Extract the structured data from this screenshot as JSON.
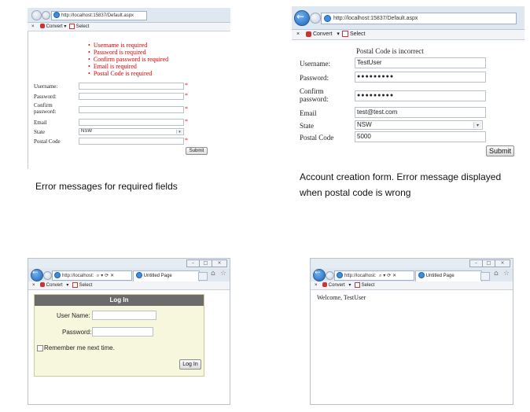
{
  "panels": {
    "p1": {
      "url": "http://localhost:15837/Default.aspx",
      "toolbar": {
        "close": "×",
        "convert": "Convert",
        "convert_arrow": "▾",
        "select": "Select"
      },
      "errors": [
        "Username is required",
        "Password is required",
        "Confirm password is required",
        "Email is required",
        "Postal Code is required"
      ],
      "labels": {
        "username": "Username:",
        "password": "Password:",
        "confirm_1": "Confirm",
        "confirm_2": "password:",
        "email": "Email",
        "state": "State",
        "postal": "Postal Code"
      },
      "state_value": "NSW",
      "required_mark": "*",
      "submit": "Submit",
      "caption": "Error messages for required fields"
    },
    "p2": {
      "url": "http://localhost:15837/Default.aspx",
      "toolbar": {
        "close": "×",
        "convert": "Convert",
        "convert_arrow": "▾",
        "select": "Select"
      },
      "message": "Postal Code is incorrect",
      "labels": {
        "username": "Username:",
        "password": "Password:",
        "confirm_1": "Confirm",
        "confirm_2": "password:",
        "email": "Email",
        "state": "State",
        "postal": "Postal Code"
      },
      "values": {
        "username": "TestUser",
        "password": "●●●●●●●●●",
        "confirm": "●●●●●●●●●",
        "email": "test@test.com",
        "state": "NSW",
        "postal": "5000"
      },
      "submit": "Submit",
      "caption_1": "Account creation form. Error message displayed",
      "caption_2": "when postal code is wrong"
    },
    "p3": {
      "url": "http://localhost:",
      "tab": "Untitled Page",
      "toolbar": {
        "close": "×",
        "convert": "Convert",
        "convert_arrow": "▾",
        "select": "Select"
      },
      "window_controls": [
        "–",
        "□",
        "×"
      ],
      "login": {
        "title": "Log In",
        "username_label": "User Name:",
        "password_label": "Password:",
        "remember": "Remember me next time.",
        "button": "Log In"
      },
      "colors": {
        "header": "#6b6b6b",
        "panel": "#f7f7de",
        "border": "#cccc99"
      }
    },
    "p4": {
      "url": "http://localhost:",
      "tab": "Untitled Page",
      "toolbar": {
        "close": "×",
        "convert": "Convert",
        "convert_arrow": "▾",
        "select": "Select"
      },
      "window_controls": [
        "–",
        "□",
        "×"
      ],
      "welcome": "Welcome, TestUser"
    }
  }
}
